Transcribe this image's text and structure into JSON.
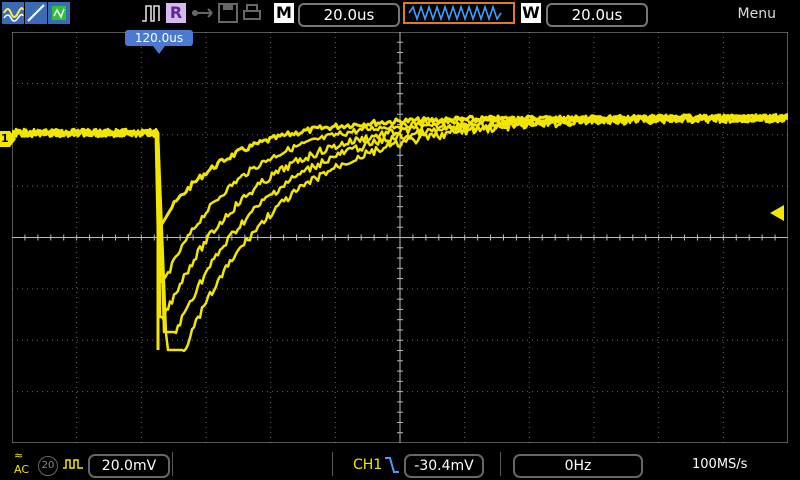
{
  "header": {
    "memory_label": "M",
    "timebase": "20.0us",
    "window_label": "W",
    "window_timebase": "20.0us",
    "menu_label": "Menu",
    "trigger_mode_label": "R"
  },
  "screen": {
    "trigger_time": "120.0us",
    "channel_marker": "1",
    "trace_color": "#f2e600"
  },
  "footer": {
    "coupling": "AC",
    "bw_limit": "20",
    "volts_div": "20.0mV",
    "trigger_source": "CH1",
    "trigger_level": "-30.4mV",
    "frequency": "0Hz",
    "sample_rate": "100MS/s"
  },
  "colors": {
    "trace": "#f2e600",
    "accent_blue": "#4a7bd0",
    "orange": "#e07a1a"
  }
}
